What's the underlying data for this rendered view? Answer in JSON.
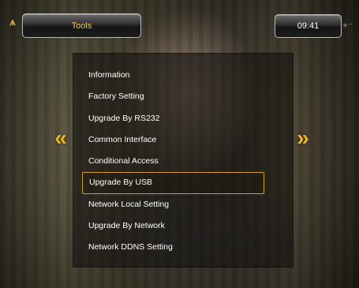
{
  "header": {
    "title": "Tools",
    "time": "09:41"
  },
  "icons": {
    "logo": "satellite-signal-icon",
    "left_arrow": "double-chevron-left-icon",
    "right_arrow": "double-chevron-right-icon"
  },
  "colors": {
    "accent": "#f4b41c",
    "title_text": "#ffcc33",
    "selection_border": "#d89b22"
  },
  "menu": {
    "selected_index": 5,
    "items": [
      {
        "label": "Information"
      },
      {
        "label": "Factory Setting"
      },
      {
        "label": "Upgrade By RS232"
      },
      {
        "label": "Common Interface"
      },
      {
        "label": "Conditional Access"
      },
      {
        "label": "Upgrade By USB"
      },
      {
        "label": "Network Local Setting"
      },
      {
        "label": "Upgrade By Network"
      },
      {
        "label": "Network DDNS Setting"
      }
    ]
  }
}
